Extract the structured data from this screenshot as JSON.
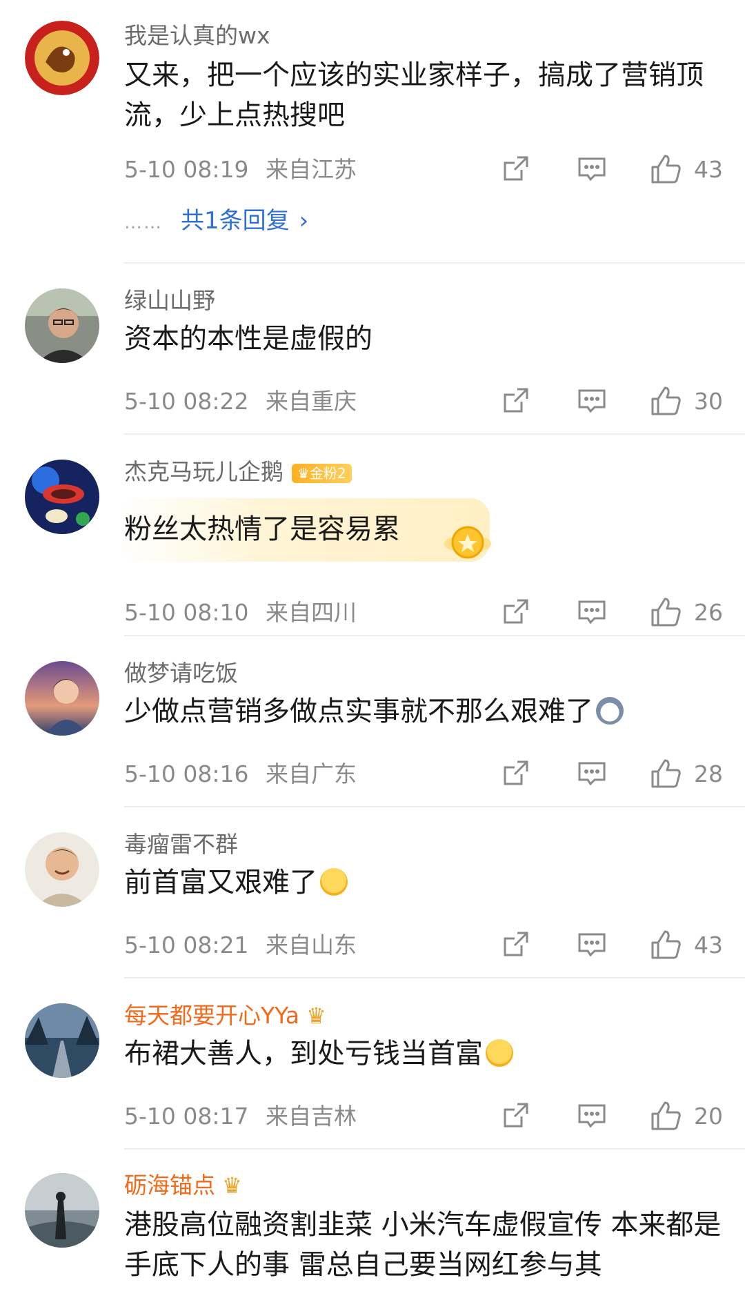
{
  "colors": {
    "name_gray": "#6b6b6b",
    "name_vip": "#f26a1b",
    "link_blue": "#2f6fd6",
    "meta_gray": "#8a8a8a"
  },
  "icons": {
    "share": "share-icon",
    "comment": "comment-icon",
    "like": "thumbs-up-icon"
  },
  "comments": [
    {
      "name": "我是认真的wx",
      "text": "又来，把一个应该的实业家样子，搞成了营销顶流，少上点热搜吧",
      "time": "5-10 08:19",
      "location": "来自江苏",
      "likes": "43",
      "replies": "共1条回复"
    },
    {
      "name": "绿山山野",
      "text": "资本的本性是虚假的",
      "time": "5-10 08:22",
      "location": "来自重庆",
      "likes": "30"
    },
    {
      "name": "杰克马玩儿企鹅",
      "badge": "金粉2",
      "text": "粉丝太热情了是容易累",
      "time": "5-10 08:10",
      "location": "来自四川",
      "likes": "26"
    },
    {
      "name": "做梦请吃饭",
      "text": "少做点营销多做点实事就不那么艰难了",
      "time": "5-10 08:16",
      "location": "来自广东",
      "likes": "28"
    },
    {
      "name": "毒瘤雷不群",
      "text": "前首富又艰难了",
      "time": "5-10 08:21",
      "location": "来自山东",
      "likes": "43"
    },
    {
      "name": "每天都要开心YYa",
      "text": "布裙大善人，到处亏钱当首富",
      "time": "5-10 08:17",
      "location": "来自吉林",
      "likes": "20"
    },
    {
      "name": "砺海锚点",
      "text": "港股高位融资割韭菜  小米汽车虚假宣传 本来都是手底下人的事 雷总自己要当网红参与其"
    }
  ]
}
